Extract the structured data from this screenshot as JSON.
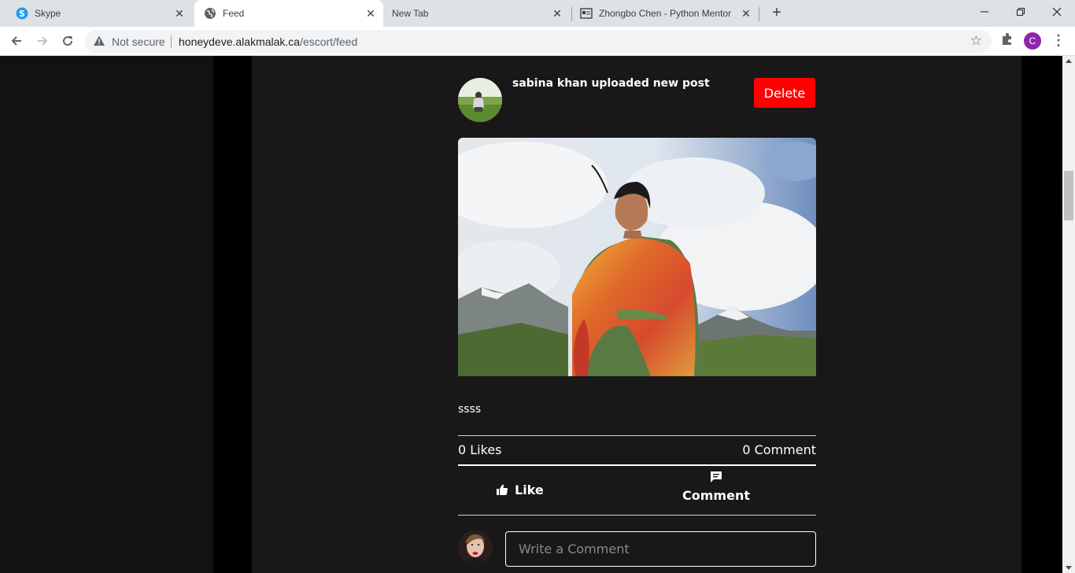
{
  "browser": {
    "tabs": [
      {
        "label": "Skype",
        "icon": "skype-icon",
        "active": false
      },
      {
        "label": "Feed",
        "icon": "globe-icon",
        "active": true
      },
      {
        "label": "New Tab",
        "icon": "",
        "active": false
      },
      {
        "label": "Zhongbo Chen - Python Mentor",
        "icon": "page-icon",
        "active": false
      }
    ],
    "security_label": "Not secure",
    "url_host": "honeydeve.alakmalak.ca",
    "url_path": "/escort/feed",
    "profile_initial": "C"
  },
  "post": {
    "author_line": "sabina khan uploaded new post",
    "delete_label": "Delete",
    "caption": "ssss",
    "likes_label": "0 Likes",
    "comments_label": "0 Comment",
    "like_button": "Like",
    "comment_button": "Comment",
    "comment_placeholder": "Write a Comment"
  },
  "colors": {
    "delete": "#ff0000",
    "page_bg": "#181818",
    "profile": "#8e24aa"
  }
}
